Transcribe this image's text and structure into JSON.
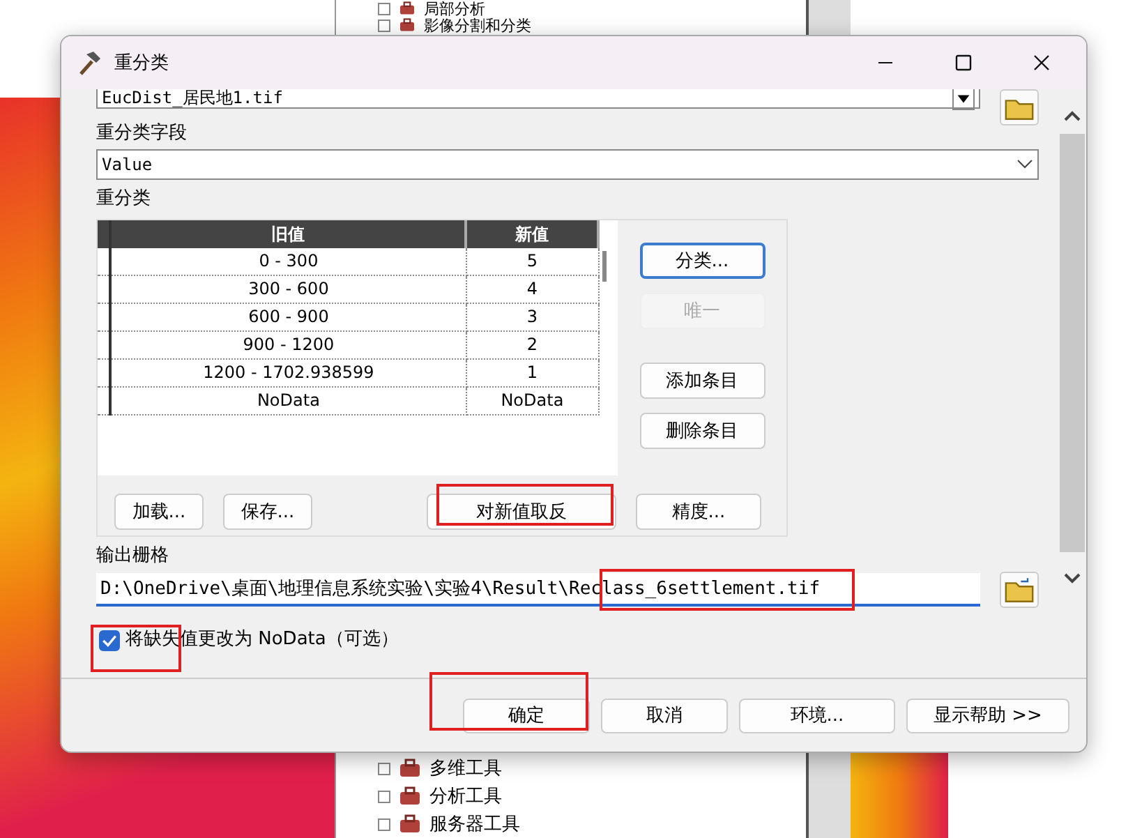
{
  "background_tree": {
    "items": [
      {
        "label": "局部分析"
      },
      {
        "label": "影像分割和分类"
      },
      {
        "label": "多维工具"
      },
      {
        "label": "分析工具"
      },
      {
        "label": "服务器工具"
      }
    ]
  },
  "window": {
    "title": "重分类"
  },
  "input_raster": {
    "value": "EucDist_居民地1.tif"
  },
  "reclass_field": {
    "label": "重分类字段",
    "value": "Value"
  },
  "reclassification": {
    "label": "重分类",
    "columns": [
      "旧值",
      "新值"
    ],
    "rows": [
      {
        "old": "0 - 300",
        "new": "5"
      },
      {
        "old": "300 - 600",
        "new": "4"
      },
      {
        "old": "600 - 900",
        "new": "3"
      },
      {
        "old": "900 - 1200",
        "new": "2"
      },
      {
        "old": "1200 - 1702.938599",
        "new": "1"
      },
      {
        "old": "NoData",
        "new": "NoData"
      }
    ],
    "side_buttons": [
      {
        "label": "分类...",
        "disabled": false
      },
      {
        "label": "唯一",
        "disabled": true
      },
      {
        "label": "添加条目",
        "disabled": false
      },
      {
        "label": "删除条目",
        "disabled": false
      }
    ],
    "bottom_buttons": [
      {
        "label": "加载..."
      },
      {
        "label": "保存..."
      },
      {
        "label": "对新值取反"
      },
      {
        "label": "精度..."
      }
    ]
  },
  "output_raster": {
    "label": "输出栅格",
    "value": "D:\\OneDrive\\桌面\\地理信息系统实验\\实验4\\Result\\Reclass_6settlement.tif"
  },
  "nodata_option": {
    "label": "将缺失值更改为 NoData（可选）",
    "checked": true
  },
  "buttons": [
    {
      "label": "确定"
    },
    {
      "label": "取消"
    },
    {
      "label": "环境..."
    },
    {
      "label": "显示帮助 >>"
    }
  ]
}
